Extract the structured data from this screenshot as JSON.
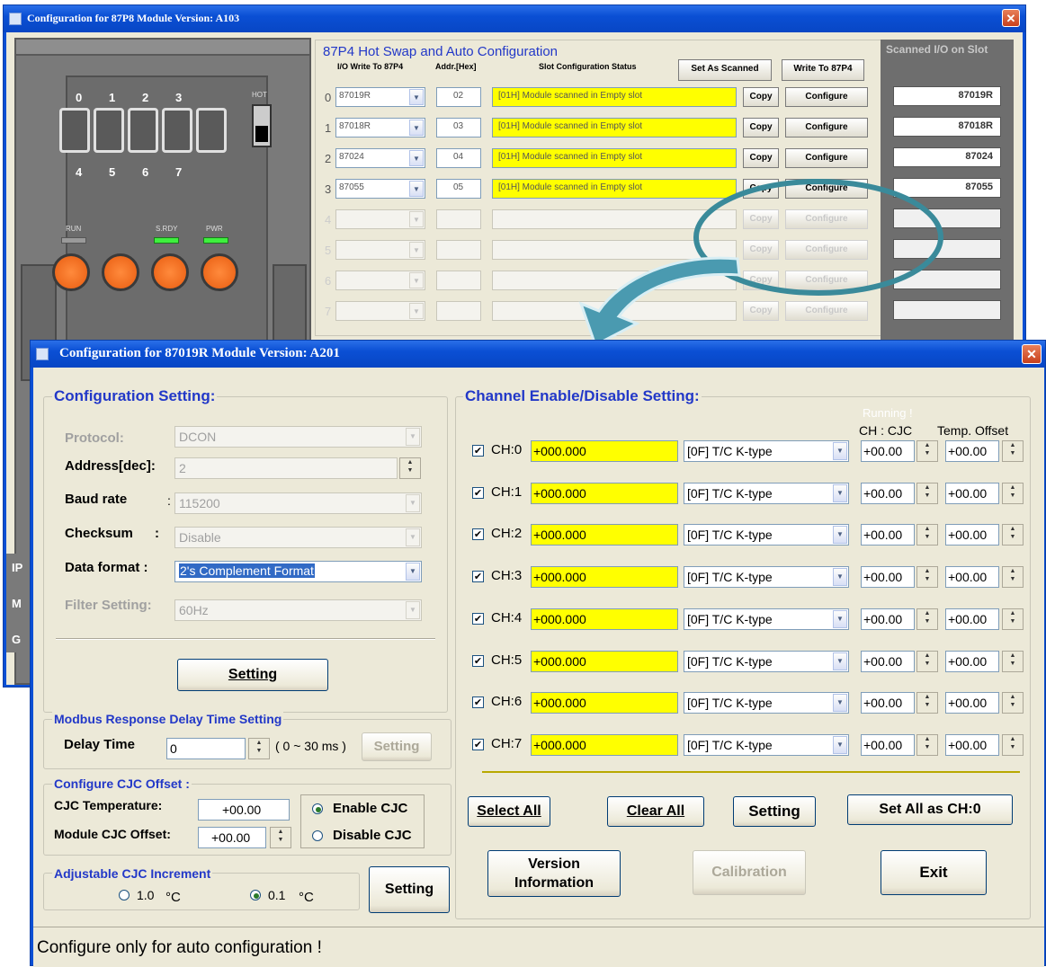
{
  "back_window": {
    "title": "Configuration for 87P8 Module Version: A103",
    "close": "✕",
    "device": {
      "digits_top": [
        "0",
        "1",
        "2",
        "3"
      ],
      "digits_bottom": [
        "4",
        "5",
        "6",
        "7"
      ],
      "hot_label": "HOT",
      "led_labels": [
        "RUN",
        "S.RDY",
        "PWR"
      ]
    },
    "left_edge_letters": [
      "IP",
      "M",
      "G"
    ],
    "hotswap": {
      "title": "87P4 Hot Swap and Auto Configuration",
      "col_io": "I/O Write To 87P4",
      "col_addr": "Addr.[Hex]",
      "col_status": "Slot Configuration Status",
      "set_as_scanned": "Set As Scanned",
      "write_to": "Write To 87P4",
      "copy": "Copy",
      "configure": "Configure",
      "rows": [
        {
          "idx": "0",
          "module": "87019R",
          "addr": "02",
          "status": "[01H] Module scanned in Empty slot"
        },
        {
          "idx": "1",
          "module": "87018R",
          "addr": "03",
          "status": "[01H] Module scanned in Empty slot"
        },
        {
          "idx": "2",
          "module": "87024",
          "addr": "04",
          "status": "[01H] Module scanned in Empty slot"
        },
        {
          "idx": "3",
          "module": "87055",
          "addr": "05",
          "status": "[01H] Module scanned in Empty slot"
        },
        {
          "idx": "4",
          "module": "",
          "addr": "",
          "status": ""
        },
        {
          "idx": "5",
          "module": "",
          "addr": "",
          "status": ""
        },
        {
          "idx": "6",
          "module": "",
          "addr": "",
          "status": ""
        },
        {
          "idx": "7",
          "module": "",
          "addr": "",
          "status": ""
        }
      ]
    },
    "scanned": {
      "title": "Scanned I/O on Slot",
      "slots": [
        "87019R",
        "87018R",
        "87024",
        "87055",
        "",
        "",
        "",
        ""
      ]
    }
  },
  "front_window": {
    "title": "Configuration for 87019R Module Version: A201",
    "close": "✕",
    "config": {
      "title": "Configuration Setting:",
      "protocol_label": "Protocol:",
      "protocol_value": "DCON",
      "address_label": "Address[dec]:",
      "address_value": "2",
      "baud_label": "Baud rate",
      "baud_colon": ":",
      "baud_value": "115200",
      "checksum_label": "Checksum",
      "checksum_colon": ":",
      "checksum_value": "Disable",
      "format_label": "Data format :",
      "format_value": "2's Complement Format",
      "filter_label": "Filter Setting:",
      "filter_value": "60Hz",
      "setting": "Setting"
    },
    "modbus": {
      "title": "Modbus Response Delay Time Setting",
      "delay_label": "Delay Time",
      "delay_value": "0",
      "range": "( 0 ~ 30 ms )",
      "setting": "Setting"
    },
    "cjc": {
      "title": "Configure CJC Offset :",
      "temp_label": "CJC Temperature:",
      "temp_value": "+00.00",
      "offset_label": "Module CJC Offset:",
      "offset_value": "+00.00",
      "enable": "Enable CJC",
      "disable": "Disable CJC"
    },
    "increment": {
      "title": "Adjustable CJC Increment",
      "opt1": "1.0",
      "opt2": "0.1",
      "unit": "°C",
      "setting": "Setting"
    },
    "channels": {
      "title": "Channel Enable/Disable Setting:",
      "running": "Running !",
      "col_cjc": "CH : CJC",
      "col_offset": "Temp. Offset",
      "check": "✔",
      "rows": [
        {
          "label": "CH:0",
          "value": "+000.000",
          "type": "[0F] T/C K-type",
          "cjc": "+00.00",
          "offset": "+00.00"
        },
        {
          "label": "CH:1",
          "value": "+000.000",
          "type": "[0F] T/C K-type",
          "cjc": "+00.00",
          "offset": "+00.00"
        },
        {
          "label": "CH:2",
          "value": "+000.000",
          "type": "[0F] T/C K-type",
          "cjc": "+00.00",
          "offset": "+00.00"
        },
        {
          "label": "CH:3",
          "value": "+000.000",
          "type": "[0F] T/C K-type",
          "cjc": "+00.00",
          "offset": "+00.00"
        },
        {
          "label": "CH:4",
          "value": "+000.000",
          "type": "[0F] T/C K-type",
          "cjc": "+00.00",
          "offset": "+00.00"
        },
        {
          "label": "CH:5",
          "value": "+000.000",
          "type": "[0F] T/C K-type",
          "cjc": "+00.00",
          "offset": "+00.00"
        },
        {
          "label": "CH:6",
          "value": "+000.000",
          "type": "[0F] T/C K-type",
          "cjc": "+00.00",
          "offset": "+00.00"
        },
        {
          "label": "CH:7",
          "value": "+000.000",
          "type": "[0F] T/C K-type",
          "cjc": "+00.00",
          "offset": "+00.00"
        }
      ],
      "select_all": "Select All",
      "clear_all": "Clear All",
      "setting": "Setting",
      "set_all": "Set All as CH:0",
      "version": "Version Information",
      "calibration": "Calibration",
      "exit": "Exit"
    },
    "status_bar": "Configure only for auto configuration !"
  },
  "colors": {
    "accent_blue": "#2238c8",
    "highlight_yellow": "#ffff00",
    "arrow_teal": "#3a8a9a"
  }
}
